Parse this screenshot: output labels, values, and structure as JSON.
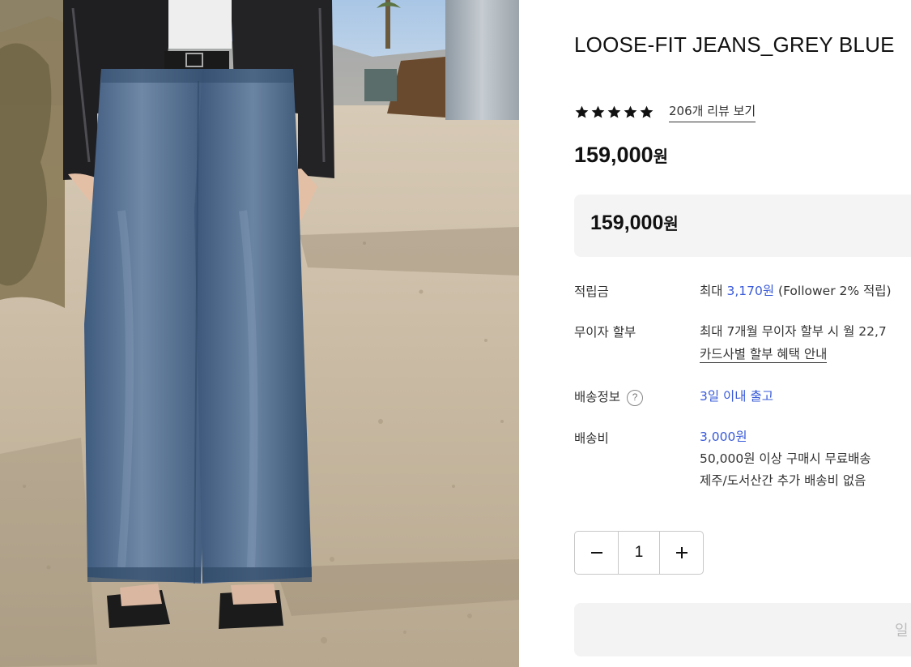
{
  "product": {
    "title": "LOOSE-FIT JEANS_GREY BLUE",
    "rating_stars": 5,
    "review_link": "206개 리뷰 보기",
    "price_amount": "159,000",
    "currency": "원",
    "total_amount": "159,000"
  },
  "details": {
    "points": {
      "label": "적립금",
      "prefix": "최대 ",
      "amount": "3,170원",
      "suffix": " (Follower 2% 적립)"
    },
    "installment": {
      "label": "무이자 할부",
      "text": "최대 7개월 무이자 할부 시 월 22,7",
      "link": "카드사별 할부 혜택 안내"
    },
    "shipping_info": {
      "label": "배송정보",
      "help_icon": "?",
      "value": "3일 이내 출고"
    },
    "shipping_fee": {
      "label": "배송비",
      "amount": "3,000원",
      "line2": "50,000원 이상 구매시 무료배송",
      "line3": "제주/도서산간 추가 배송비 없음"
    }
  },
  "quantity": {
    "value": "1",
    "decrement_icon": "minus-icon",
    "increment_icon": "plus-icon"
  },
  "buy_button": {
    "label_partial": "일"
  },
  "colors": {
    "accent_blue": "#3a5bd9",
    "panel_bg": "#f4f4f5",
    "star": "#111111"
  }
}
